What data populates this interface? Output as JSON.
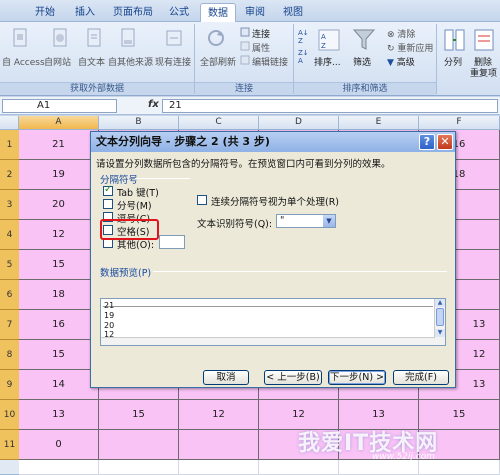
{
  "ribbon": {
    "tabs": [
      "开始",
      "插入",
      "页面布局",
      "公式",
      "数据",
      "审阅",
      "视图"
    ],
    "active_tab": "数据",
    "get_external_data": {
      "buttons": [
        "自 Access",
        "自网站",
        "自文本",
        "自其他来源",
        "现有连接"
      ],
      "label": "获取外部数据"
    },
    "connections": {
      "refresh_all": "全部刷新",
      "items": [
        "连接",
        "属性",
        "编辑链接"
      ],
      "label": "连接"
    },
    "sort_filter": {
      "sort": "排序...",
      "filter": "筛选",
      "clear": "清除",
      "reapply": "重新应用",
      "advanced": "高级",
      "label": "排序和筛选"
    },
    "data_tools": {
      "split": "分列",
      "remove_dup": "删除",
      "remove_dup2": "重复项"
    }
  },
  "formula_bar": {
    "name_box": "A1",
    "fx": "fx",
    "value": "21"
  },
  "grid": {
    "columns": [
      "A",
      "B",
      "C",
      "D",
      "E",
      "F"
    ],
    "selected_column": "A",
    "rows": [
      "1",
      "2",
      "3",
      "4",
      "5",
      "6",
      "7",
      "8",
      "9",
      "10",
      "11"
    ],
    "col_a": [
      "21",
      "19",
      "20",
      "12",
      "15",
      "18",
      "16",
      "15",
      "14",
      "13",
      "0"
    ],
    "col_f_visible": [
      "16",
      "18",
      "",
      "",
      "",
      "",
      "13",
      "12",
      "13"
    ],
    "row10": [
      "15",
      "12",
      "12",
      "13",
      "15"
    ]
  },
  "dialog": {
    "title": "文本分列向导 - 步骤之 2 (共 3 步)",
    "help": "?",
    "close": "✕",
    "description": "请设置分列数据所包含的分隔符号。在预览窗口内可看到分列的效果。",
    "delimiters_label": "分隔符号",
    "options": [
      {
        "label": "Tab 键(T)",
        "checked": true
      },
      {
        "label": "分号(M)",
        "checked": false
      },
      {
        "label": "逗号(C)",
        "checked": false
      },
      {
        "label": "空格(S)",
        "checked": false
      },
      {
        "label": "其他(O):",
        "checked": false
      }
    ],
    "consecutive_label": "连续分隔符号视为单个处理(R)",
    "qualifier_label": "文本识别符号(Q):",
    "qualifier_value": "\"",
    "preview_label": "数据预览(P)",
    "preview_lines": [
      "21",
      "19",
      "20",
      "12"
    ],
    "buttons": {
      "cancel": "取消",
      "back": "< 上一步(B)",
      "next": "下一步(N) >",
      "finish": "完成(F)"
    }
  },
  "watermark": {
    "text": "我爱IT技术网",
    "sub": "www.52ij.com"
  }
}
